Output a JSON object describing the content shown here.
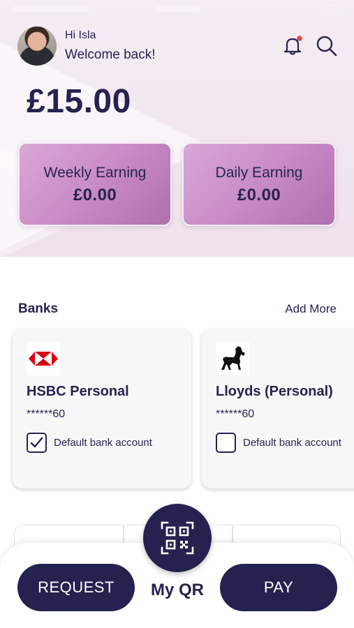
{
  "user": {
    "greeting": "Hi Isla",
    "welcome": "Welcome back!"
  },
  "balance": "£15.00",
  "earnings": {
    "weekly": {
      "label": "Weekly Earning",
      "value": "£0.00"
    },
    "daily": {
      "label": "Daily Earning",
      "value": "£0.00"
    }
  },
  "banks": {
    "title": "Banks",
    "add_more": "Add More",
    "items": [
      {
        "name": "HSBC Personal",
        "account": "******60",
        "default_label": "Default bank account",
        "is_default": true,
        "logo": "hsbc-logo"
      },
      {
        "name": "Lloyds (Personal)",
        "account": "******60",
        "default_label": "Default bank account",
        "is_default": false,
        "logo": "lloyds-horse-logo"
      }
    ]
  },
  "actions": {
    "request": "REQUEST",
    "my_qr": "My QR",
    "pay": "PAY"
  },
  "icons": {
    "notification": "bell-icon",
    "search": "search-icon",
    "qr": "qr-code-icon",
    "check": "checkmark-icon"
  },
  "colors": {
    "primary": "#25224f",
    "card_gradient_start": "#d9a8d6",
    "card_gradient_end": "#b06fae",
    "notification_dot": "#e8473b",
    "hsbc_red": "#db0011"
  }
}
